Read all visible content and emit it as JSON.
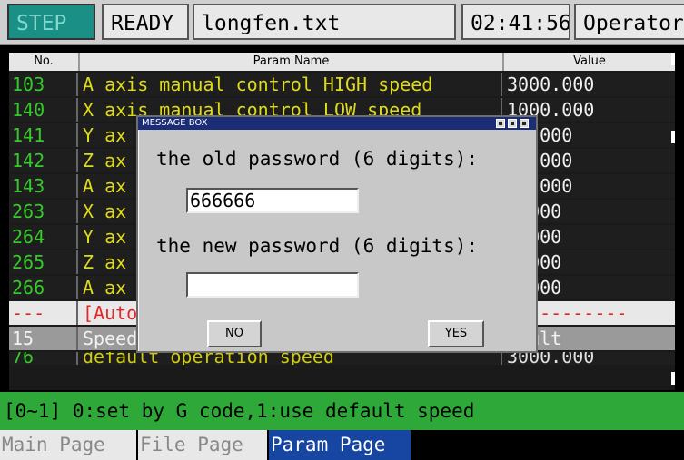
{
  "status": {
    "mode": "STEP",
    "state": "READY",
    "file": "longfen.txt",
    "time": "02:41:56",
    "user": "Operator"
  },
  "table": {
    "headers": {
      "no": "No.",
      "name": "Param Name",
      "value": "Value"
    },
    "rows": [
      {
        "no": "103",
        "name": "A axis manual control HIGH speed",
        "value": "3000.000"
      },
      {
        "no": "140",
        "name": "X axis manual control LOW speed",
        "value": "1000.000"
      },
      {
        "no": "141",
        "name": "Y ax",
        "value": "00.000"
      },
      {
        "no": "142",
        "name": "Z ax",
        "value": "00.000"
      },
      {
        "no": "143",
        "name": "A ax",
        "value": "00.000"
      },
      {
        "no": "263",
        "name": "X ax",
        "value": ").000"
      },
      {
        "no": "264",
        "name": "Y ax",
        "value": ").000"
      },
      {
        "no": "265",
        "name": "Z ax",
        "value": ").000"
      },
      {
        "no": "266",
        "name": "A ax",
        "value": ").000"
      },
      {
        "no": "---",
        "name": "[Auto",
        "value": "-----------"
      },
      {
        "no": "15",
        "name": "Speed",
        "value": "fault"
      },
      {
        "no": "76",
        "name": "default operation speed",
        "value": "3000.000"
      }
    ]
  },
  "dialog": {
    "title": "MESSAGE BOX",
    "old_label": "the old password (6 digits):",
    "old_value": "666666",
    "new_label": "the new password (6 digits):",
    "new_value": "",
    "no_label": "NO",
    "yes_label": "YES"
  },
  "help": "[0~1]  0:set by G code,1:use default speed",
  "tabs": [
    "Main Page",
    "File Page",
    "Param Page"
  ],
  "active_tab": "Param Page",
  "colors": {
    "mode_bg": "#1a8f86",
    "help_bg": "#2ea838",
    "active_tab_bg": "#1646a2",
    "dialog_title_bg": "#1c2d78"
  }
}
